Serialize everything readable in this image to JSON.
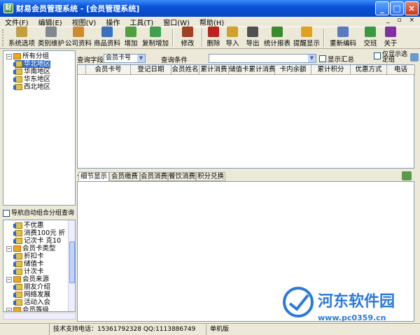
{
  "window": {
    "title": "财易会员管理系统 - [会员管理系统]"
  },
  "menu": [
    "文件(F)",
    "编辑(E)",
    "视图(V)",
    "操作",
    "工具(T)",
    "窗口(W)",
    "帮助(H)"
  ],
  "toolbar": [
    {
      "label": "系统选项",
      "icon": "settings-icon",
      "color": "#c0a040"
    },
    {
      "label": "类别维护",
      "icon": "tools-icon",
      "color": "#808890"
    },
    {
      "label": "公司资料",
      "icon": "company-icon",
      "color": "#d08a30"
    },
    {
      "label": "商品资料",
      "icon": "product-icon",
      "color": "#3a70c0"
    },
    {
      "label": "增加",
      "icon": "add-icon",
      "color": "#50a040"
    },
    {
      "label": "复制增加",
      "icon": "copy-add-icon",
      "color": "#40a050"
    },
    {
      "label": "修改",
      "icon": "edit-icon",
      "color": "#a04020"
    },
    {
      "label": "删除",
      "icon": "delete-icon",
      "color": "#c02020"
    },
    {
      "label": "导入",
      "icon": "import-icon",
      "color": "#d0a030"
    },
    {
      "label": "导出",
      "icon": "export-icon",
      "color": "#505050"
    },
    {
      "label": "统计报表",
      "icon": "chart-icon",
      "color": "#3a8a30"
    },
    {
      "label": "提醒显示",
      "icon": "reminder-icon",
      "color": "#e0a020"
    },
    {
      "label": "重新编码",
      "icon": "recode-icon",
      "color": "#5a7ac0"
    },
    {
      "label": "交班",
      "icon": "shift-icon",
      "color": "#3a9a40"
    },
    {
      "label": "关于",
      "icon": "help-icon",
      "color": "#8030a0"
    }
  ],
  "tree_top": [
    {
      "label": "所有分组",
      "level": 0,
      "expanded": true
    },
    {
      "label": "华北地区",
      "level": 1,
      "selected": true
    },
    {
      "label": "华南地区",
      "level": 1
    },
    {
      "label": "华东地区",
      "level": 1
    },
    {
      "label": "西北地区",
      "level": 1
    }
  ],
  "auto_group": {
    "label": "导航自动组合分组查询",
    "checked": false
  },
  "tree_bottom": [
    {
      "label": "不优惠",
      "level": 1
    },
    {
      "label": "消费100元 折",
      "level": 1
    },
    {
      "label": "记次卡 克10",
      "level": 1
    },
    {
      "label": "会员卡类型",
      "level": 0
    },
    {
      "label": "折扣卡",
      "level": 1
    },
    {
      "label": "储值卡",
      "level": 1
    },
    {
      "label": "计次卡",
      "level": 1
    },
    {
      "label": "会员来源",
      "level": 0
    },
    {
      "label": "朋友介绍",
      "level": 1
    },
    {
      "label": "网络发展",
      "level": 1
    },
    {
      "label": "活动入会",
      "level": 1
    },
    {
      "label": "会员等级",
      "level": 0
    }
  ],
  "query": {
    "field_label": "查询字段",
    "field_value": "会员卡号",
    "cond_label": "查询条件",
    "cond_value": "",
    "show_summary": "显示汇总",
    "show_only": "仅显示选定组"
  },
  "columns": [
    "会员卡号",
    "登记日期",
    "会员姓名",
    "累计消费",
    "储值卡累计消费",
    "卡内余额",
    "累计积分",
    "优惠方式",
    "电话"
  ],
  "tabs": [
    "细节显示",
    "会员缴费",
    "会员消费",
    "餐饮消费",
    "积分兑换"
  ],
  "status": {
    "phone": "技术支持电话：15361792328 QQ:1113886749",
    "mode": "单机版"
  },
  "watermark": {
    "text": "河东软件园",
    "url": "www.pc0359.cn"
  }
}
